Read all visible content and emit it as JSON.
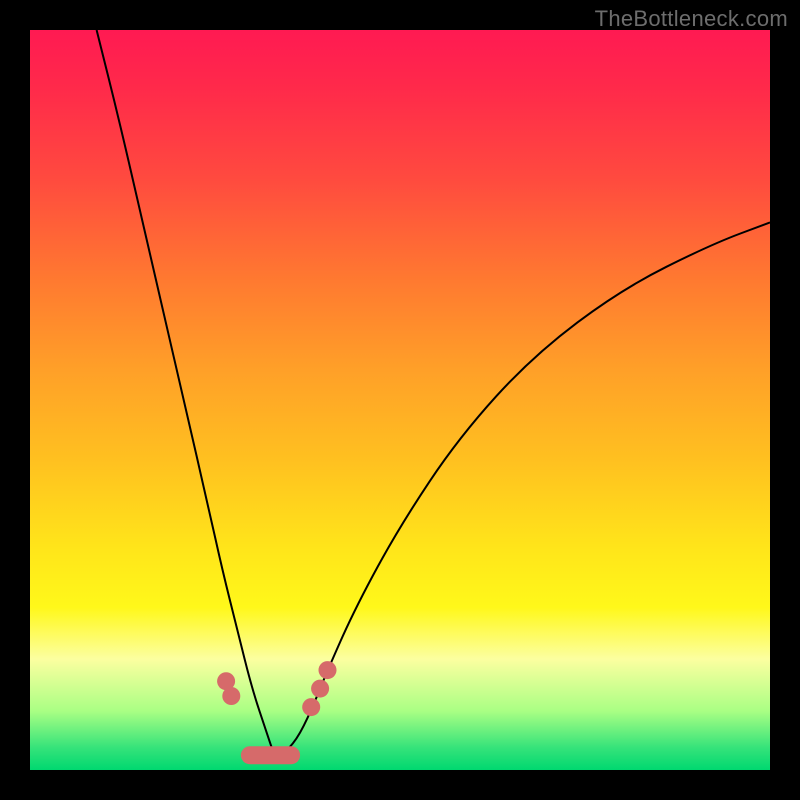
{
  "watermark": "TheBottleneck.com",
  "chart_data": {
    "type": "line",
    "title": "",
    "xlabel": "",
    "ylabel": "",
    "xlim": [
      0,
      100
    ],
    "ylim": [
      0,
      100
    ],
    "grid": false,
    "legend": false,
    "description": "V-shaped bottleneck curve over red-to-green vertical gradient. Curve minimum near x≈33, y≈2. Left branch starts near top-left, right branch exits near right edge around y≈73.",
    "series": [
      {
        "name": "bottleneck-curve",
        "x": [
          9,
          12,
          15,
          18,
          21,
          24,
          26,
          28,
          30,
          32,
          33,
          34,
          36,
          38,
          40,
          44,
          50,
          58,
          68,
          80,
          92,
          100
        ],
        "y": [
          100,
          88,
          75,
          62,
          49,
          36,
          27,
          19,
          11,
          5,
          2,
          2,
          4,
          8,
          13,
          22,
          33,
          45,
          56,
          65,
          71,
          74
        ]
      }
    ],
    "markers": {
      "dots": [
        {
          "x": 26.5,
          "y": 12
        },
        {
          "x": 27.2,
          "y": 10
        },
        {
          "x": 38.0,
          "y": 8.5
        },
        {
          "x": 39.2,
          "y": 11
        },
        {
          "x": 40.2,
          "y": 13.5
        }
      ],
      "pill": {
        "x_start": 28.5,
        "x_end": 36.5,
        "y": 2
      }
    },
    "gradient_stops": [
      {
        "pos": 0,
        "color": "#ff1a52"
      },
      {
        "pos": 20,
        "color": "#ff4a3f"
      },
      {
        "pos": 46,
        "color": "#ffa028"
      },
      {
        "pos": 70,
        "color": "#ffe51a"
      },
      {
        "pos": 92,
        "color": "#aaff84"
      },
      {
        "pos": 100,
        "color": "#00d870"
      }
    ]
  }
}
